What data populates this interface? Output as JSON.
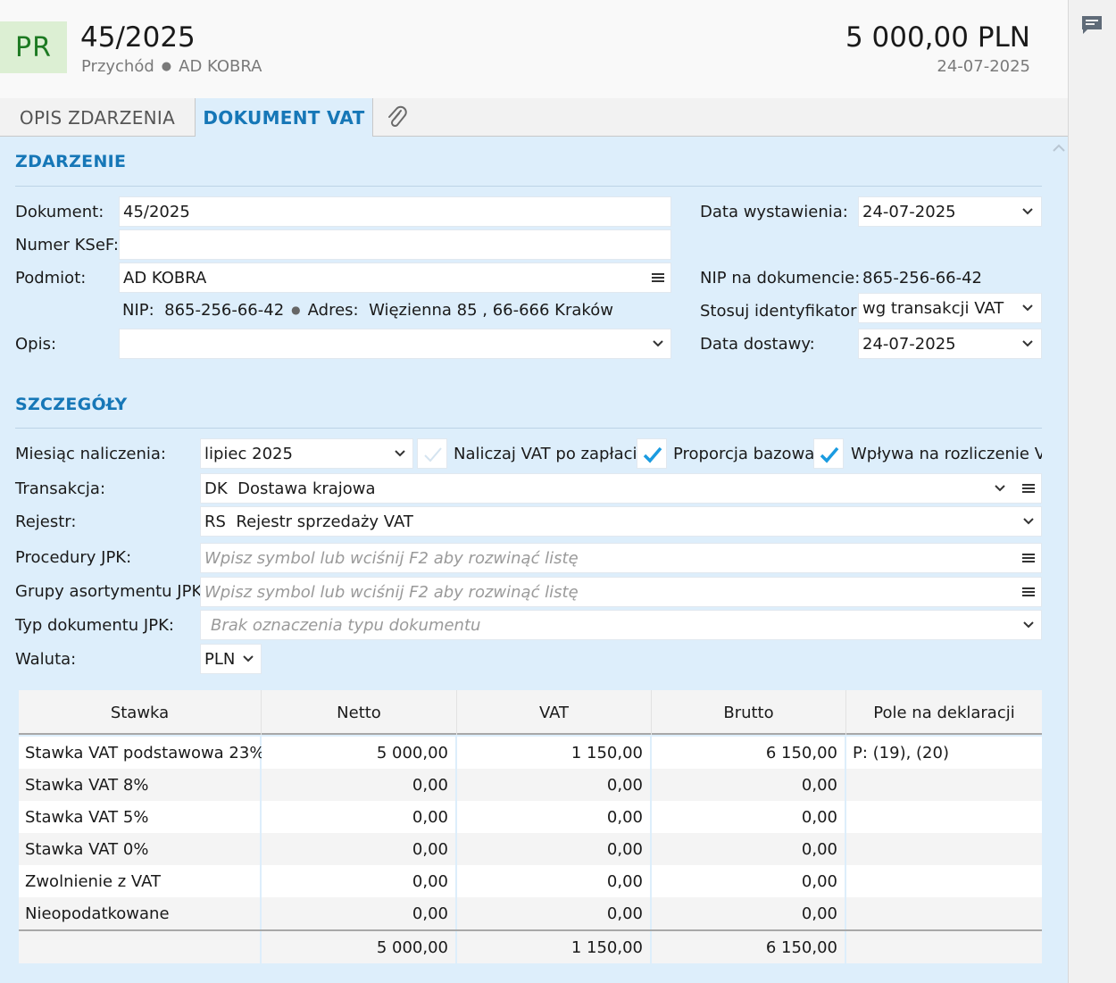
{
  "header": {
    "badge": "PR",
    "title": "45/2025",
    "type": "Przychód",
    "party": "AD KOBRA",
    "amount": "5 000,00 PLN",
    "date": "24-07-2025"
  },
  "tabs": [
    {
      "label": "OPIS ZDARZENIA",
      "active": false
    },
    {
      "label": "DOKUMENT VAT",
      "active": true
    }
  ],
  "sections": {
    "event": "ZDARZENIE",
    "details": "SZCZEGÓŁY"
  },
  "event": {
    "document_label": "Dokument:",
    "document_value": "45/2025",
    "ksef_label": "Numer KSeF:",
    "ksef_value": "",
    "party_label": "Podmiot:",
    "party_value": "AD KOBRA",
    "nip_label": "NIP:",
    "nip_value": "865-256-66-42",
    "address_label": "Adres:",
    "address_value": "Więzienna  85 , 66-666 Kraków",
    "desc_label": "Opis:",
    "desc_value": "",
    "issue_date_label": "Data wystawienia:",
    "issue_date_value": "24-07-2025",
    "doc_nip_label": "NIP na dokumencie:",
    "doc_nip_value": "865-256-66-42",
    "identifier_label": "Stosuj identyfikator:",
    "identifier_value": "wg transakcji VAT",
    "delivery_date_label": "Data dostawy:",
    "delivery_date_value": "24-07-2025"
  },
  "details": {
    "month_label": "Miesiąc naliczenia:",
    "month_value": "lipiec 2025",
    "cb_vat_after_payment": {
      "label": "Naliczaj VAT po zapłacie",
      "checked": false
    },
    "cb_base_proportion": {
      "label": "Proporcja bazowa",
      "checked": true
    },
    "cb_affects_vat": {
      "label": "Wpływa na rozliczenie VAT",
      "checked": true
    },
    "transaction_label": "Transakcja:",
    "transaction_code": "DK",
    "transaction_name": "Dostawa krajowa",
    "register_label": "Rejestr:",
    "register_code": "RS",
    "register_name": "Rejestr sprzedaży VAT",
    "jpk_proc_label": "Procedury JPK:",
    "jpk_proc_placeholder": "Wpisz symbol lub wciśnij F2 aby rozwinąć listę",
    "jpk_groups_label": "Grupy asortymentu JPK:",
    "jpk_groups_placeholder": "Wpisz symbol lub wciśnij F2 aby rozwinąć listę",
    "jpk_type_label": "Typ dokumentu JPK:",
    "jpk_type_placeholder": "Brak oznaczenia typu dokumentu",
    "currency_label": "Waluta:",
    "currency_value": "PLN"
  },
  "table": {
    "headers": [
      "Stawka",
      "Netto",
      "VAT",
      "Brutto",
      "Pole na deklaracji"
    ],
    "rows": [
      {
        "rate": "Stawka VAT podstawowa 23%",
        "net": "5 000,00",
        "vat": "1 150,00",
        "gross": "6 150,00",
        "field": "P: (19), (20)"
      },
      {
        "rate": "Stawka VAT 8%",
        "net": "0,00",
        "vat": "0,00",
        "gross": "0,00",
        "field": ""
      },
      {
        "rate": "Stawka VAT 5%",
        "net": "0,00",
        "vat": "0,00",
        "gross": "0,00",
        "field": ""
      },
      {
        "rate": "Stawka VAT 0%",
        "net": "0,00",
        "vat": "0,00",
        "gross": "0,00",
        "field": ""
      },
      {
        "rate": "Zwolnienie z VAT",
        "net": "0,00",
        "vat": "0,00",
        "gross": "0,00",
        "field": ""
      },
      {
        "rate": "Nieopodatkowane",
        "net": "0,00",
        "vat": "0,00",
        "gross": "0,00",
        "field": ""
      }
    ],
    "totals": {
      "net": "5 000,00",
      "vat": "1 150,00",
      "gross": "6 150,00"
    }
  },
  "icons": {
    "comment": "comment-icon",
    "attachment": "paperclip-icon",
    "dropdown": "chevron-down-icon",
    "list": "list-menu-icon",
    "check": "check-icon"
  },
  "colors": {
    "accent": "#1677b7",
    "badge_bg": "#dcefd3",
    "badge_fg": "#1d7a22",
    "content_bg": "#ddeefb",
    "check": "#1a9be0"
  }
}
